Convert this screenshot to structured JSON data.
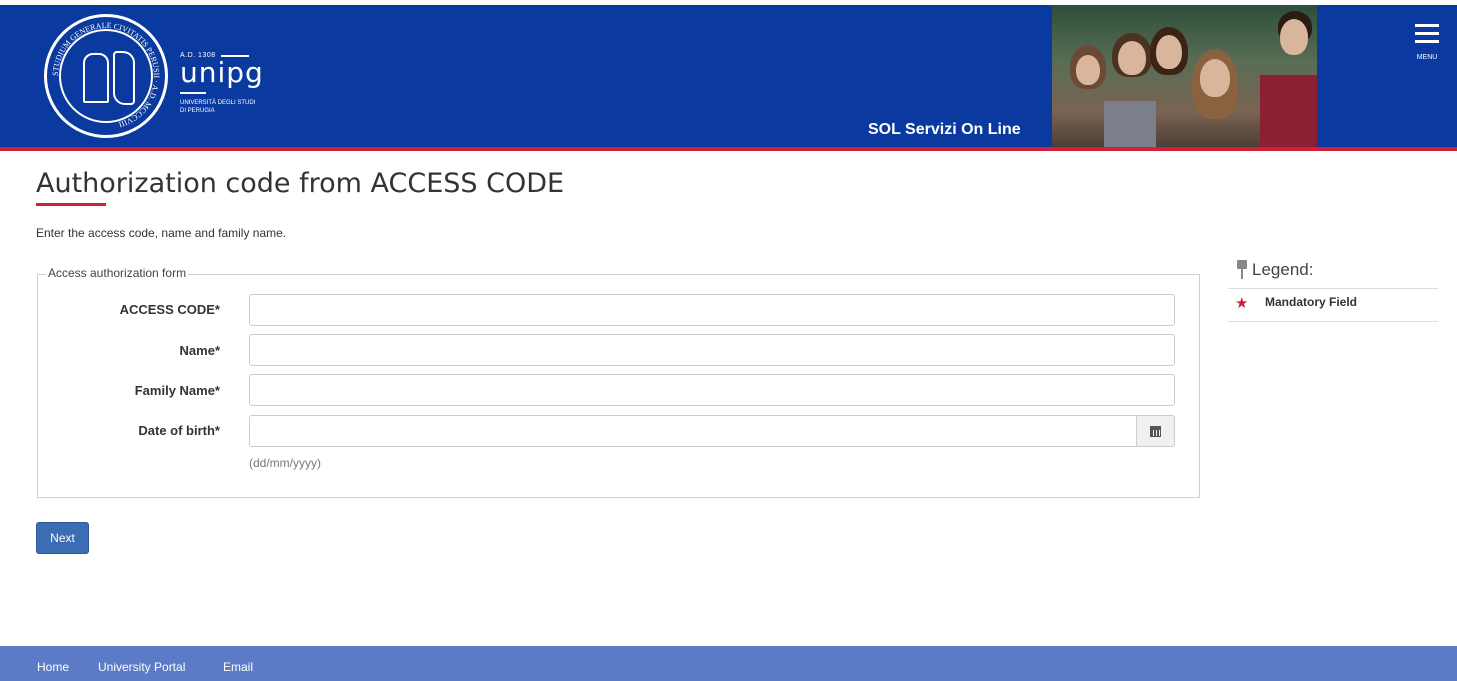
{
  "header": {
    "seal_text": "STUDIUM GENERALE CIVITATIS PERUSII · A.D. MCCCVIII",
    "brand_year": "A.D. 1308",
    "brand_name": "unipg",
    "brand_sub_line1": "UNIVERSITÀ DEGLI STUDI",
    "brand_sub_line2": "DI PERUGIA",
    "service_title": "SOL Servizi On Line",
    "menu_label": "MENU"
  },
  "page": {
    "title": "Authorization code from ACCESS CODE",
    "intro": "Enter the access code, name and family name."
  },
  "form": {
    "legend": "Access authorization form",
    "fields": [
      {
        "label": "ACCESS CODE*",
        "value": "",
        "placeholder": ""
      },
      {
        "label": "Name*",
        "value": "",
        "placeholder": ""
      },
      {
        "label": "Family Name*",
        "value": "",
        "placeholder": ""
      },
      {
        "label": "Date of birth*",
        "value": "",
        "placeholder": ""
      }
    ],
    "date_hint": "(dd/mm/yyyy)",
    "next_label": "Next"
  },
  "legend_panel": {
    "title": "Legend:",
    "item_label": "Mandatory Field",
    "star_color": "#d1203a"
  },
  "footer": {
    "links": [
      "Home",
      "University Portal",
      "Email"
    ]
  },
  "colors": {
    "header_blue": "#0a3aa0",
    "accent_red": "#d1203a",
    "footer_blue": "#5b7bc6",
    "button_blue": "#3a6db3"
  }
}
